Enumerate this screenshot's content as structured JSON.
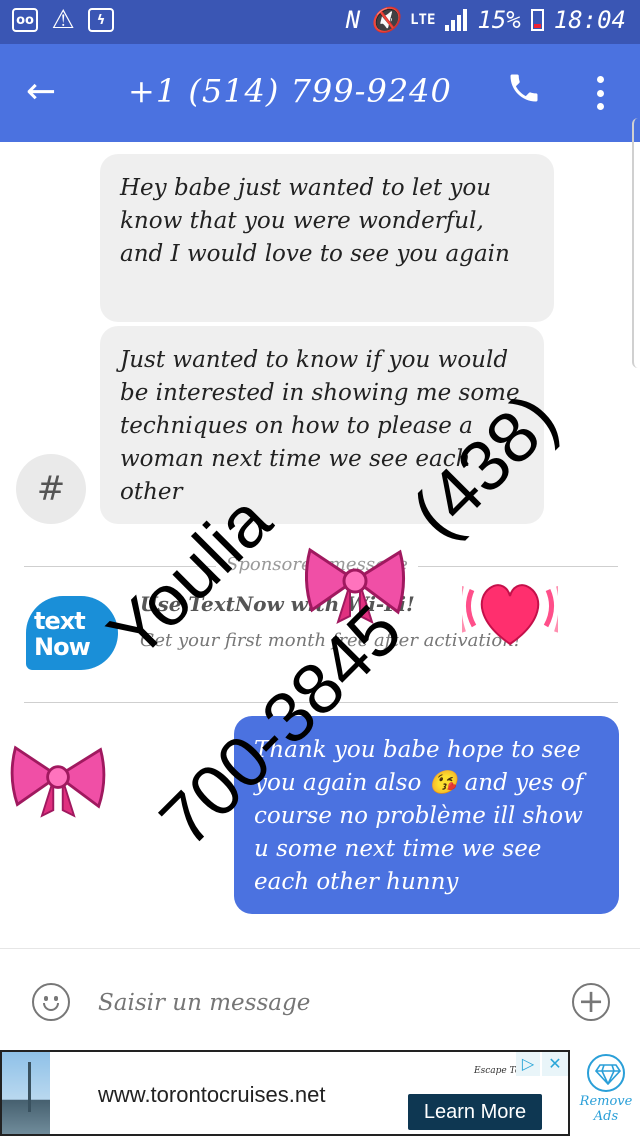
{
  "status_bar": {
    "left_icons": [
      "voicemail-icon",
      "warning-icon",
      "messenger-icon"
    ],
    "network_type": "LTE",
    "battery": "15%",
    "time": "18:04"
  },
  "header": {
    "title": "+1 (514) 799-9240"
  },
  "messages": [
    {
      "direction": "incoming",
      "text": "Hey babe just wanted to let you know that you were wonderful, and I would love to see you again"
    },
    {
      "direction": "incoming",
      "text": "Just wanted to know if you would be interested in showing me some techniques on how to please a woman next time we see each other"
    },
    {
      "direction": "outgoing",
      "text": "Thank you babe hope to see you again also 😘 and yes of course no problème ill show u some next time we see each other hunny"
    }
  ],
  "contact_avatar": "#",
  "sponsored": {
    "label": "Sponsored message",
    "logo_text": "text Now",
    "title": "Use TextNow with Wi-Fi!",
    "subtitle": "Get your first month free after activation!"
  },
  "overlay": {
    "name": "Youlia",
    "area_code": "(438)",
    "number": "700-3845"
  },
  "composer": {
    "placeholder": "Saisir un message"
  },
  "ad": {
    "url": "www.torontocruises.net",
    "brand": "Escape To",
    "cta": "Learn More",
    "choice_icon": "▷",
    "close_icon": "✕",
    "remove_label": "Remove Ads"
  },
  "colors": {
    "status_bar": "#3a56b4",
    "app_bar": "#4b72e0",
    "incoming_bubble": "#efefef",
    "outgoing_bubble": "#4b72e0",
    "bow": "#f04fa6",
    "heart": "#ff2f6e"
  }
}
